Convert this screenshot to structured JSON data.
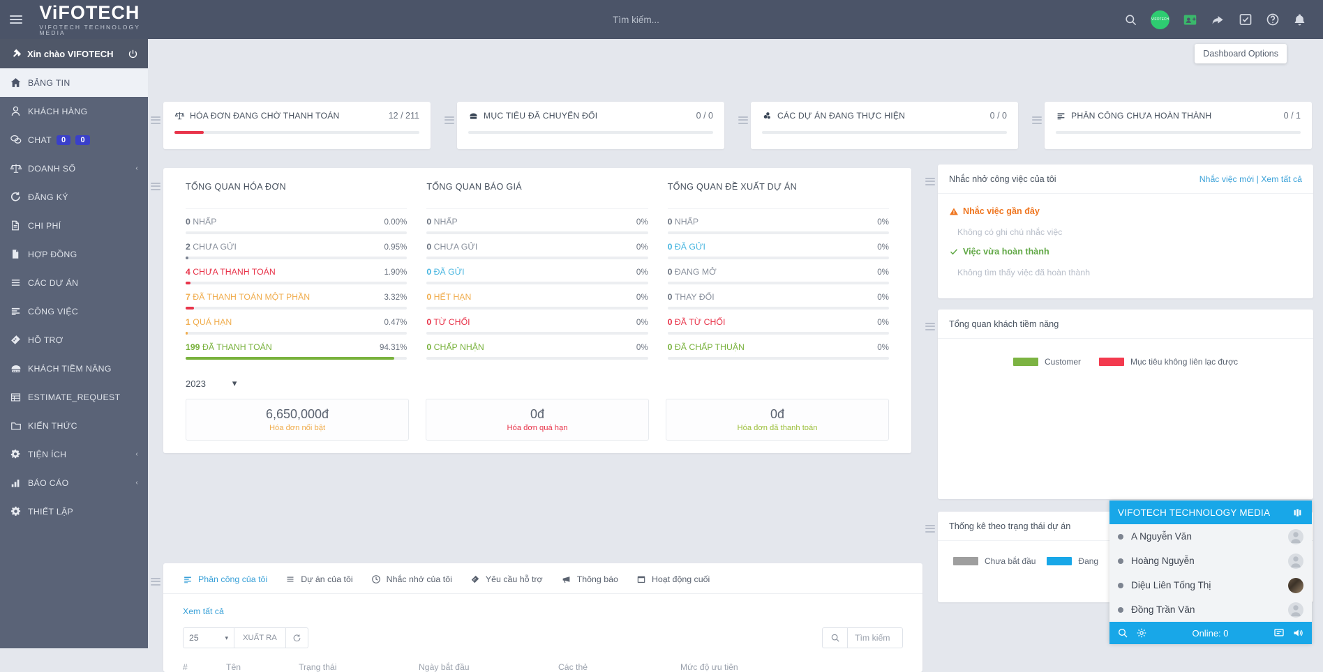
{
  "topbar": {
    "brand_main": "ViFOTECH",
    "brand_sub": "VIFOTECH TECHNOLOGY MEDIA",
    "search_placeholder": "Tìm kiếm...",
    "avatar_label": "VIFOTECH"
  },
  "tooltip": {
    "dashboard_options": "Dashboard Options"
  },
  "sidebar": {
    "greeting": "Xin chào VIFOTECH",
    "items": [
      {
        "label": "BẢNG TIN",
        "icon": "home-icon",
        "active": true
      },
      {
        "label": "KHÁCH HÀNG",
        "icon": "user-icon"
      },
      {
        "label": "CHAT",
        "icon": "chat-icon",
        "badges": [
          "0",
          "0"
        ]
      },
      {
        "label": "DOANH SỐ",
        "icon": "scales-icon",
        "caret": "‹"
      },
      {
        "label": "ĐĂNG KÝ",
        "icon": "refresh-icon"
      },
      {
        "label": "CHI PHÍ",
        "icon": "file-lines-icon"
      },
      {
        "label": "HỢP ĐỒNG",
        "icon": "document-icon"
      },
      {
        "label": "CÁC DỰ ÁN",
        "icon": "list-icon"
      },
      {
        "label": "CÔNG VIỆC",
        "icon": "tasks-icon"
      },
      {
        "label": "HỖ TRỢ",
        "icon": "ticket-icon"
      },
      {
        "label": "KHÁCH TIỀM NĂNG",
        "icon": "leads-icon"
      },
      {
        "label": "ESTIMATE_REQUEST",
        "icon": "table-icon"
      },
      {
        "label": "KIẾN THỨC",
        "icon": "folder-icon"
      },
      {
        "label": "TIỆN ÍCH",
        "icon": "gears-icon",
        "caret": "‹"
      },
      {
        "label": "BÁO CÁO",
        "icon": "chart-icon",
        "caret": "‹"
      },
      {
        "label": "THIẾT LẬP",
        "icon": "gear-icon"
      }
    ]
  },
  "stat_cards": [
    {
      "title": "HÓA ĐƠN ĐANG CHỜ THANH TOÁN",
      "value": "12 / 211",
      "icon": "scales-icon",
      "progress": 12,
      "color": "#e8344a"
    },
    {
      "title": "MỤC TIÊU ĐÃ CHUYỂN ĐỔI",
      "value": "0 / 0",
      "icon": "leads-icon",
      "progress": 0,
      "color": "#e8344a"
    },
    {
      "title": "CÁC DỰ ÁN ĐANG THỰC HIỆN",
      "value": "0 / 0",
      "icon": "projects-icon",
      "progress": 0,
      "color": "#e8344a"
    },
    {
      "title": "PHÂN CÔNG CHƯA HOÀN THÀNH",
      "value": "0 / 1",
      "icon": "tasks-icon",
      "progress": 0,
      "color": "#e8344a"
    }
  ],
  "overview": {
    "columns": [
      {
        "title": "TỔNG QUAN HÓA ĐƠN",
        "rows": [
          {
            "count": "0",
            "label": "NHẤP",
            "pct": "0.00%",
            "bar": 0,
            "color": "#7b8391"
          },
          {
            "count": "2",
            "label": "CHƯA GỬI",
            "pct": "0.95%",
            "bar": 0.95,
            "color": "#7b8391"
          },
          {
            "count": "4",
            "label": "CHƯA THANH TOÁN",
            "pct": "1.90%",
            "bar": 1.9,
            "color": "#e8344a"
          },
          {
            "count": "7",
            "label": "ĐÃ THANH TOÁN MỘT PHẦN",
            "pct": "3.32%",
            "bar": 3.32,
            "color": "#e8344a"
          },
          {
            "count": "1",
            "label": "QUÁ HẠN",
            "pct": "0.47%",
            "bar": 0.47,
            "color": "#f0ad4e"
          },
          {
            "count": "199",
            "label": "ĐÃ THANH TOÁN",
            "pct": "94.31%",
            "bar": 94.31,
            "color": "#79b23d"
          }
        ]
      },
      {
        "title": "TỔNG QUAN BÁO GIÁ",
        "rows": [
          {
            "count": "0",
            "label": "NHẤP",
            "pct": "0%",
            "bar": 0,
            "color": "#7b8391"
          },
          {
            "count": "0",
            "label": "CHƯA GỬI",
            "pct": "0%",
            "bar": 0,
            "color": "#7b8391"
          },
          {
            "count": "0",
            "label": "ĐÃ GỬI",
            "pct": "0%",
            "bar": 0,
            "color": "#49b6e0"
          },
          {
            "count": "0",
            "label": "HẾT HẠN",
            "pct": "0%",
            "bar": 0,
            "color": "#f0ad4e"
          },
          {
            "count": "0",
            "label": "TỪ CHỐI",
            "pct": "0%",
            "bar": 0,
            "color": "#e8344a"
          },
          {
            "count": "0",
            "label": "CHẤP NHẬN",
            "pct": "0%",
            "bar": 0,
            "color": "#79b23d"
          }
        ]
      },
      {
        "title": "TỔNG QUAN ĐỀ XUẤT DỰ ÁN",
        "rows": [
          {
            "count": "0",
            "label": "NHẤP",
            "pct": "0%",
            "bar": 0,
            "color": "#7b8391"
          },
          {
            "count": "0",
            "label": "ĐÃ GỬI",
            "pct": "0%",
            "bar": 0,
            "color": "#49b6e0"
          },
          {
            "count": "0",
            "label": "ĐANG MỞ",
            "pct": "0%",
            "bar": 0,
            "color": "#7b8391"
          },
          {
            "count": "0",
            "label": "THAY ĐỔI",
            "pct": "0%",
            "bar": 0,
            "color": "#7b8391"
          },
          {
            "count": "0",
            "label": "ĐÃ TỪ CHỐI",
            "pct": "0%",
            "bar": 0,
            "color": "#e8344a"
          },
          {
            "count": "0",
            "label": "ĐÃ CHẤP THUẬN",
            "pct": "0%",
            "bar": 0,
            "color": "#79b23d"
          }
        ]
      }
    ],
    "year": "2023",
    "money": [
      {
        "value": "6,650,000đ",
        "label": "Hóa đơn nổi bật",
        "color": "#f0ad4e"
      },
      {
        "value": "0đ",
        "label": "Hóa đơn quá hạn",
        "color": "#e8344a"
      },
      {
        "value": "0đ",
        "label": "Hóa đơn đã thanh toán",
        "color": "#9cbf3b"
      }
    ]
  },
  "reminders": {
    "title": "Nhắc nhở công việc của tôi",
    "link_new": "Nhắc việc mới",
    "link_sep": "|",
    "link_all": "Xem tất cả",
    "recent_title": "Nhắc việc gần đây",
    "recent_empty": "Không có ghi chú nhắc việc",
    "done_title": "Việc vừa hoàn thành",
    "done_empty": "Không tìm thấy việc đã hoàn thành"
  },
  "leads_widget": {
    "title": "Tổng quan khách tiềm năng",
    "legend": [
      {
        "label": "Customer",
        "color": "#7cb342"
      },
      {
        "label": "Mục tiêu không liên lạc được",
        "color": "#f33a4e"
      }
    ]
  },
  "project_status_widget": {
    "title": "Thống kê theo trạng thái dự án",
    "legend": [
      {
        "label": "Chưa bắt đầu",
        "color": "#9e9e9e"
      },
      {
        "label": "Đang",
        "color": "#18a7e8"
      }
    ]
  },
  "bottom_panel": {
    "tabs": [
      {
        "label": "Phân công của tôi",
        "icon": "tasks-icon",
        "active": true
      },
      {
        "label": "Dự án của tôi",
        "icon": "list-icon"
      },
      {
        "label": "Nhắc nhở của tôi",
        "icon": "clock-icon"
      },
      {
        "label": "Yêu cầu hỗ trợ",
        "icon": "ticket-icon"
      },
      {
        "label": "Thông báo",
        "icon": "megaphone-icon"
      },
      {
        "label": "Hoạt động cuối",
        "icon": "calendar-icon"
      }
    ],
    "view_all": "Xem tất cả",
    "page_size": "25",
    "export_label": "XUẤT RA",
    "search_placeholder": "Tìm kiếm",
    "table_headers": [
      "#",
      "Tên",
      "Trạng thái",
      "Ngày bắt đầu",
      "Các thẻ",
      "Mức độ ưu tiên"
    ]
  },
  "chat_widget": {
    "title": "VIFOTECH TECHNOLOGY MEDIA",
    "contacts": [
      {
        "name": "A Nguyễn Văn",
        "has_photo": false
      },
      {
        "name": "Hoàng Nguyễn",
        "has_photo": false
      },
      {
        "name": "Diệu Liên Tống Thị",
        "has_photo": true
      },
      {
        "name": "Đồng Trần Văn",
        "has_photo": false
      }
    ],
    "online_label": "Online: 0"
  }
}
